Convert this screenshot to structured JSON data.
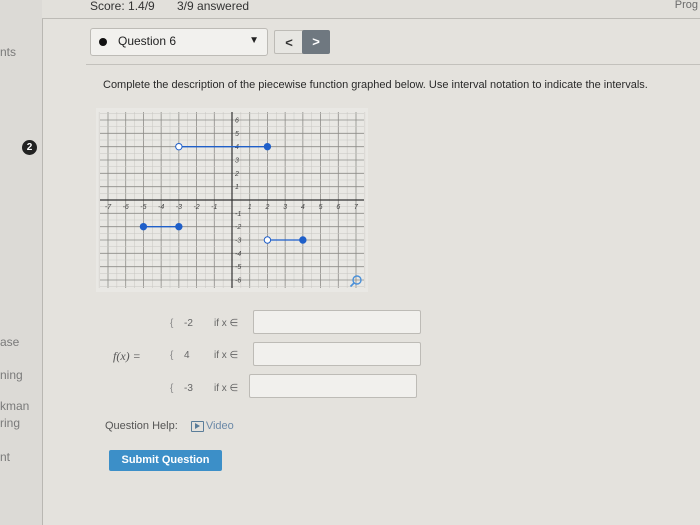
{
  "topbar": {
    "score": "Score: 1.4/9",
    "answered": "3/9 answered",
    "right_text": "Prog"
  },
  "sidebar": {
    "badge": "2",
    "fragments": [
      "nts",
      "ase",
      "ning",
      "kman",
      "ring",
      "nt"
    ]
  },
  "question_nav": {
    "selected": "Question 6",
    "prev_label": "<",
    "next_label": ">"
  },
  "prompt": "Complete the description of the piecewise function graphed below. Use interval notation to indicate the intervals.",
  "chart_data": {
    "type": "scatter",
    "xlim": [
      -7,
      7
    ],
    "ylim": [
      -6,
      6
    ],
    "grid": true,
    "x_ticks": [
      "-7",
      "-6",
      "-5",
      "-4",
      "-3",
      "-2",
      "-1",
      "1",
      "2",
      "3",
      "4",
      "5",
      "6",
      "7"
    ],
    "y_ticks": [
      "6",
      "5",
      "4",
      "3",
      "2",
      "1",
      "-1",
      "-2",
      "-3",
      "-4",
      "-5",
      "-6"
    ],
    "segments": [
      {
        "x1": -3,
        "y1": 4,
        "x2": 2,
        "y2": 4,
        "left_closed": false,
        "right_closed": true
      },
      {
        "x1": -5,
        "y1": -2,
        "x2": -3,
        "y2": -2,
        "left_closed": true,
        "right_closed": true
      },
      {
        "x1": 2,
        "y1": -3,
        "x2": 4,
        "y2": -3,
        "left_closed": false,
        "right_closed": true
      }
    ]
  },
  "function": {
    "label": "f(x) =",
    "pieces": [
      {
        "brace": "{",
        "value": "-2",
        "condition": "if x ∈"
      },
      {
        "brace": "{",
        "value": "4",
        "condition": "if x ∈"
      },
      {
        "brace": "{",
        "value": "-3",
        "condition": "if x ∈"
      }
    ]
  },
  "help": {
    "label": "Question Help:",
    "video": "Video"
  },
  "submit_label": "Submit Question",
  "colors": {
    "accent": "#3c8fc8",
    "point": "#1f5fc9"
  }
}
